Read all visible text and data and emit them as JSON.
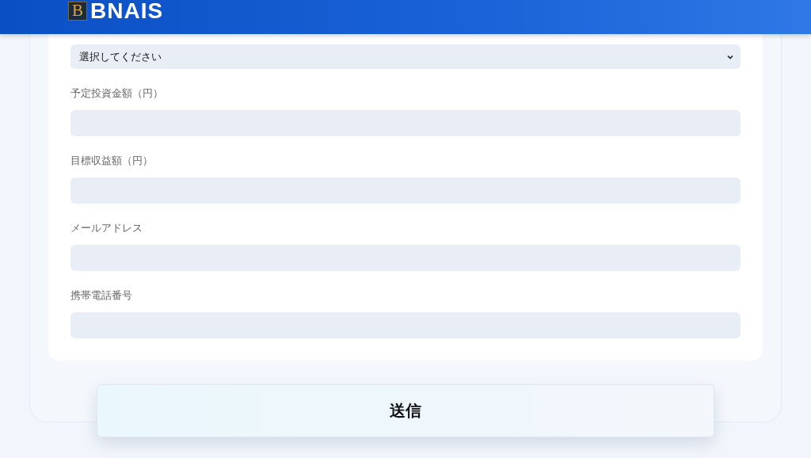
{
  "header": {
    "logo_mark": "B",
    "logo_text": "BNAIS"
  },
  "form": {
    "select": {
      "value": "選択してください"
    },
    "fields": [
      {
        "label": "予定投資金額（円）"
      },
      {
        "label": "目標収益額（円）"
      },
      {
        "label": "メールアドレス"
      },
      {
        "label": "携帯電話番号"
      }
    ]
  },
  "submit": "送信"
}
